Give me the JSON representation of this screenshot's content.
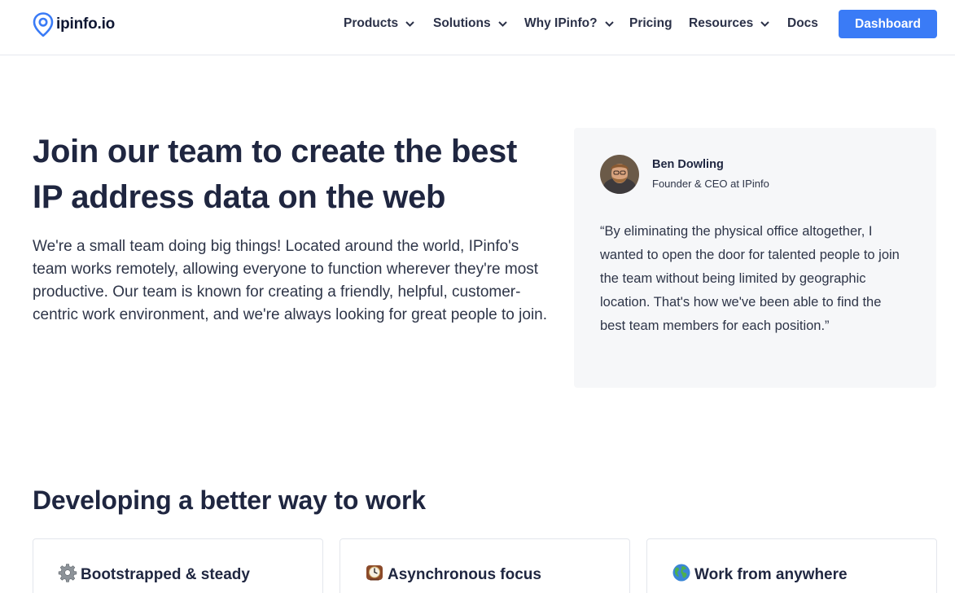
{
  "brand": {
    "name": "ipinfo.io",
    "color": "#3a7bf6"
  },
  "nav": {
    "items": [
      {
        "label": "Products",
        "has_dropdown": true
      },
      {
        "label": "Solutions",
        "has_dropdown": true
      },
      {
        "label": "Why IPinfo?",
        "has_dropdown": true
      },
      {
        "label": "Pricing",
        "has_dropdown": false
      },
      {
        "label": "Resources",
        "has_dropdown": true
      },
      {
        "label": "Docs",
        "has_dropdown": false
      }
    ],
    "cta_label": "Dashboard"
  },
  "hero": {
    "title": "Join our team to create the best IP address data on the web",
    "description": "We're a small team doing big things! Located around the world, IPinfo's team works remotely, allowing everyone to function wherever they're most productive. Our team is known for creating a friendly, helpful, customer-centric work environment, and we're always looking for great people to join."
  },
  "quote": {
    "name": "Ben Dowling",
    "role": "Founder & CEO at IPinfo",
    "text": "“By eliminating the physical office altogether, I wanted to open the door for talented people to join the team without being limited by geographic location. That's how we've been able to find the best team members for each position.”"
  },
  "features": {
    "title": "Developing a better way to work",
    "cards": [
      {
        "icon": "gear-icon",
        "title": "Bootstrapped & steady"
      },
      {
        "icon": "clock-icon",
        "title": "Asynchronous focus"
      },
      {
        "icon": "globe-icon",
        "title": "Work from anywhere"
      }
    ]
  }
}
